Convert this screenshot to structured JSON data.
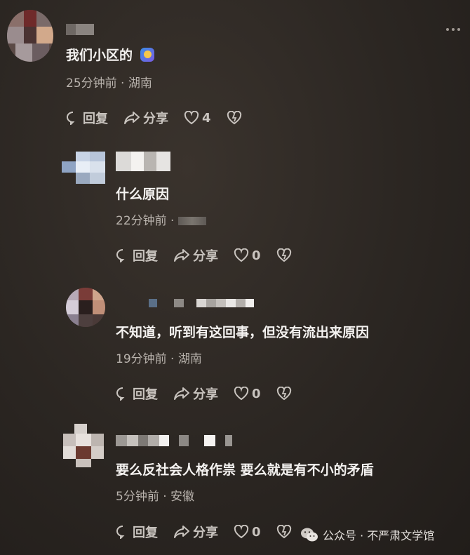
{
  "comments": [
    {
      "text": "我们小区的",
      "time": "25分钟前",
      "location": "湖南",
      "reply_label": "回复",
      "share_label": "分享",
      "likes": "4"
    },
    {
      "text": "什么原因",
      "time": "22分钟前",
      "location": "",
      "reply_label": "回复",
      "share_label": "分享",
      "likes": "0"
    },
    {
      "text": "不知道，听到有这回事，但没有流出来原因",
      "time": "19分钟前",
      "location": "湖南",
      "reply_label": "回复",
      "share_label": "分享",
      "likes": "0"
    },
    {
      "text": "要么反社会人格作祟 要么就是有不小的矛盾",
      "time": "5分钟前",
      "location": "安徽",
      "reply_label": "回复",
      "share_label": "分享",
      "likes": "0"
    }
  ],
  "separator": "·",
  "watermark": {
    "text": "公众号 · 不严肃文学馆"
  },
  "icons": [
    "more-icon",
    "reply-icon",
    "share-icon",
    "heart-icon",
    "broken-heart-icon",
    "emoji-icon",
    "wechat-icon"
  ]
}
